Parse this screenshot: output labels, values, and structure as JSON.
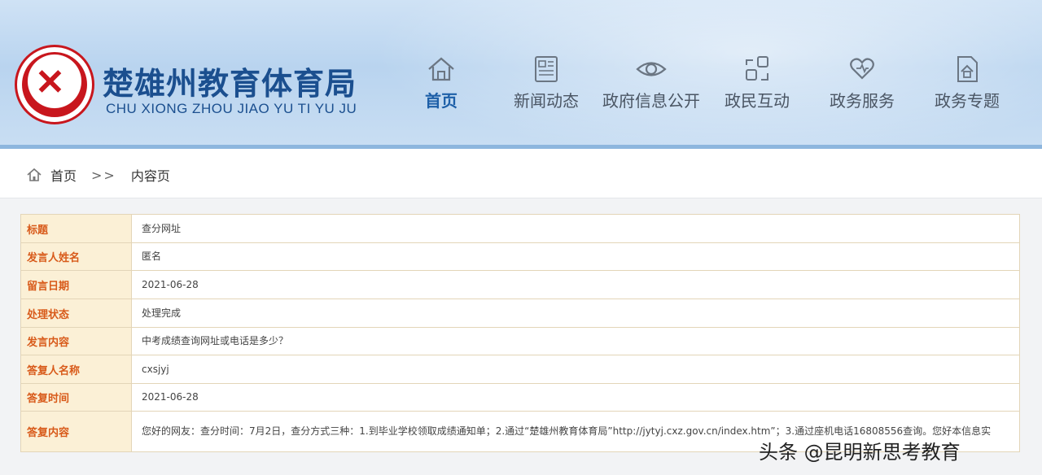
{
  "header": {
    "title": "楚雄州教育体育局",
    "pinyin": "CHU XIONG ZHOU JIAO YU TI YU JU",
    "nav": [
      {
        "label": "首页",
        "icon": "home-icon",
        "active": true
      },
      {
        "label": "新闻动态",
        "icon": "news-icon",
        "active": false
      },
      {
        "label": "政府信息公开",
        "icon": "eye-icon",
        "active": false
      },
      {
        "label": "政民互动",
        "icon": "interaction-icon",
        "active": false
      },
      {
        "label": "政务服务",
        "icon": "heart-hand-icon",
        "active": false
      },
      {
        "label": "政务专题",
        "icon": "topic-icon",
        "active": false
      }
    ]
  },
  "breadcrumb": {
    "home": "首页",
    "separator": ">>",
    "current": "内容页"
  },
  "detail": {
    "rows": [
      {
        "label": "标题",
        "value": "查分网址"
      },
      {
        "label": "发言人姓名",
        "value": "匿名"
      },
      {
        "label": "留言日期",
        "value": "2021-06-28"
      },
      {
        "label": "处理状态",
        "value": "处理完成"
      },
      {
        "label": "发言内容",
        "value": "中考成绩查询网址或电话是多少？"
      },
      {
        "label": "答复人名称",
        "value": "cxsjyj"
      },
      {
        "label": "答复时间",
        "value": "2021-06-28"
      },
      {
        "label": "答复内容",
        "value": "您好的网友：查分时间：7月2日，查分方式三种：1.到毕业学校领取成绩通知单；2.通过“楚雄州教育体育局”http://jytyj.cxz.gov.cn/index.htm”；3.通过座机电话16808556查询。您好本信息实"
      }
    ]
  },
  "watermark": "头条 @昆明新思考教育",
  "colors": {
    "title_blue": "#1b4f8f",
    "label_orange": "#d85a1a",
    "label_bg": "#fbf0d6",
    "logo_red": "#c8161d"
  }
}
